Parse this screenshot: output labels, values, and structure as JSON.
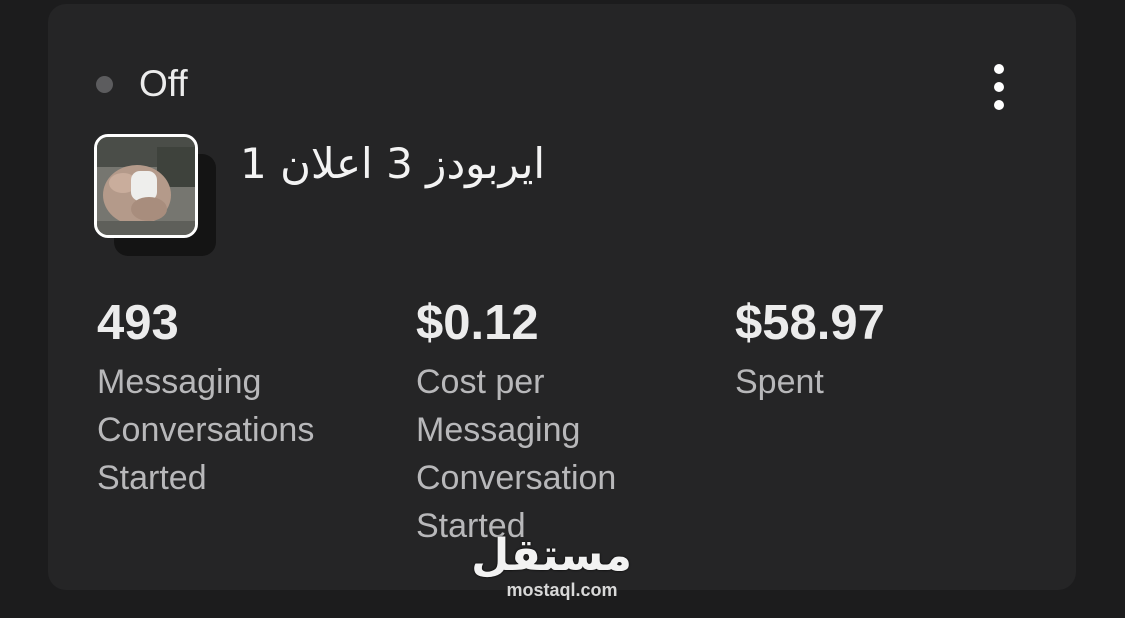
{
  "campaign": {
    "status_label": "Off",
    "ad_name": "ايربودز 3 اعلان 1"
  },
  "metrics": [
    {
      "value": "493",
      "label": "Messaging\nConversations\nStarted"
    },
    {
      "value": "$0.12",
      "label": "Cost per\nMessaging\nConversation\nStarted"
    },
    {
      "value": "$58.97",
      "label": "Spent"
    }
  ],
  "watermark": {
    "logo_text": "مستقل",
    "url": "mostaql.com"
  },
  "icons": {
    "status": "status-dot-icon",
    "menu": "more-vertical-icon",
    "thumbnail": "ad-thumbnail-image"
  },
  "colors": {
    "background": "#1c1c1d",
    "card": "#252526",
    "status_off": "#5c5c5e",
    "text_primary": "#ececec",
    "text_secondary": "#b8b8ba"
  }
}
